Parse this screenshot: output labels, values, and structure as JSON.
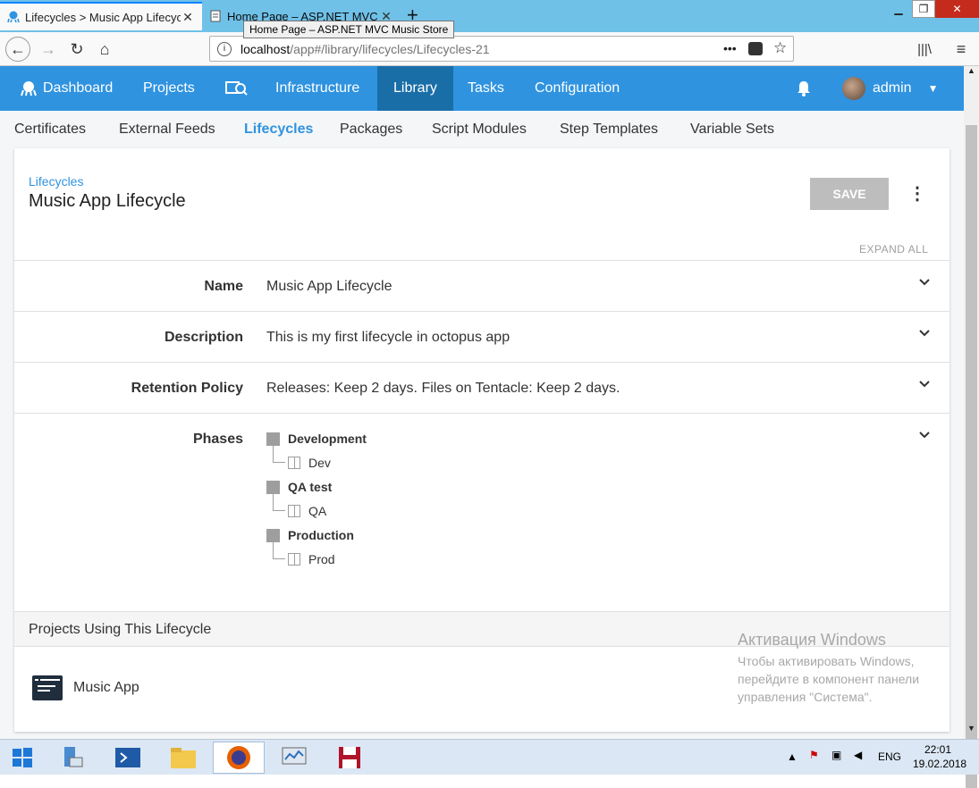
{
  "browser": {
    "tabs": [
      {
        "title": "Lifecycles > Music App Lifecycle"
      },
      {
        "title": "Home Page – ASP.NET MVC Music Store"
      }
    ],
    "tooltip": "Home Page – ASP.NET MVC Music Store",
    "url_host": "localhost",
    "url_path": "/app#/library/lifecycles/Lifecycles-21",
    "url_actions_label": "•••"
  },
  "header": {
    "nav": [
      "Dashboard",
      "Projects",
      "Infrastructure",
      "Library",
      "Tasks",
      "Configuration"
    ],
    "user": "admin"
  },
  "subnav": [
    "Certificates",
    "External Feeds",
    "Lifecycles",
    "Packages",
    "Script Modules",
    "Step Templates",
    "Variable Sets"
  ],
  "page": {
    "breadcrumb": "Lifecycles",
    "title": "Music App Lifecycle",
    "save_label": "SAVE",
    "expand_all": "EXPAND ALL",
    "fields": [
      {
        "label": "Name",
        "value": "Music App Lifecycle"
      },
      {
        "label": "Description",
        "value": "This is my first lifecycle in octopus app"
      },
      {
        "label": "Retention Policy",
        "value": "Releases: Keep 2 days. Files on Tentacle: Keep 2 days."
      }
    ],
    "phases_label": "Phases",
    "phases": [
      {
        "name": "Development",
        "env": "Dev"
      },
      {
        "name": "QA test",
        "env": "QA"
      },
      {
        "name": "Production",
        "env": "Prod"
      }
    ],
    "projects_header": "Projects Using This Lifecycle",
    "projects": [
      "Music App"
    ]
  },
  "watermark": {
    "title": "Активация Windows",
    "line1": "Чтобы активировать Windows,",
    "line2": "перейдите в компонент панели",
    "line3": "управления \"Система\"."
  },
  "taskbar": {
    "lang": "ENG",
    "time": "22:01",
    "date": "19.02.2018"
  },
  "colors": {
    "brand": "#2f93e0",
    "nav_active": "#1a6ea8"
  }
}
